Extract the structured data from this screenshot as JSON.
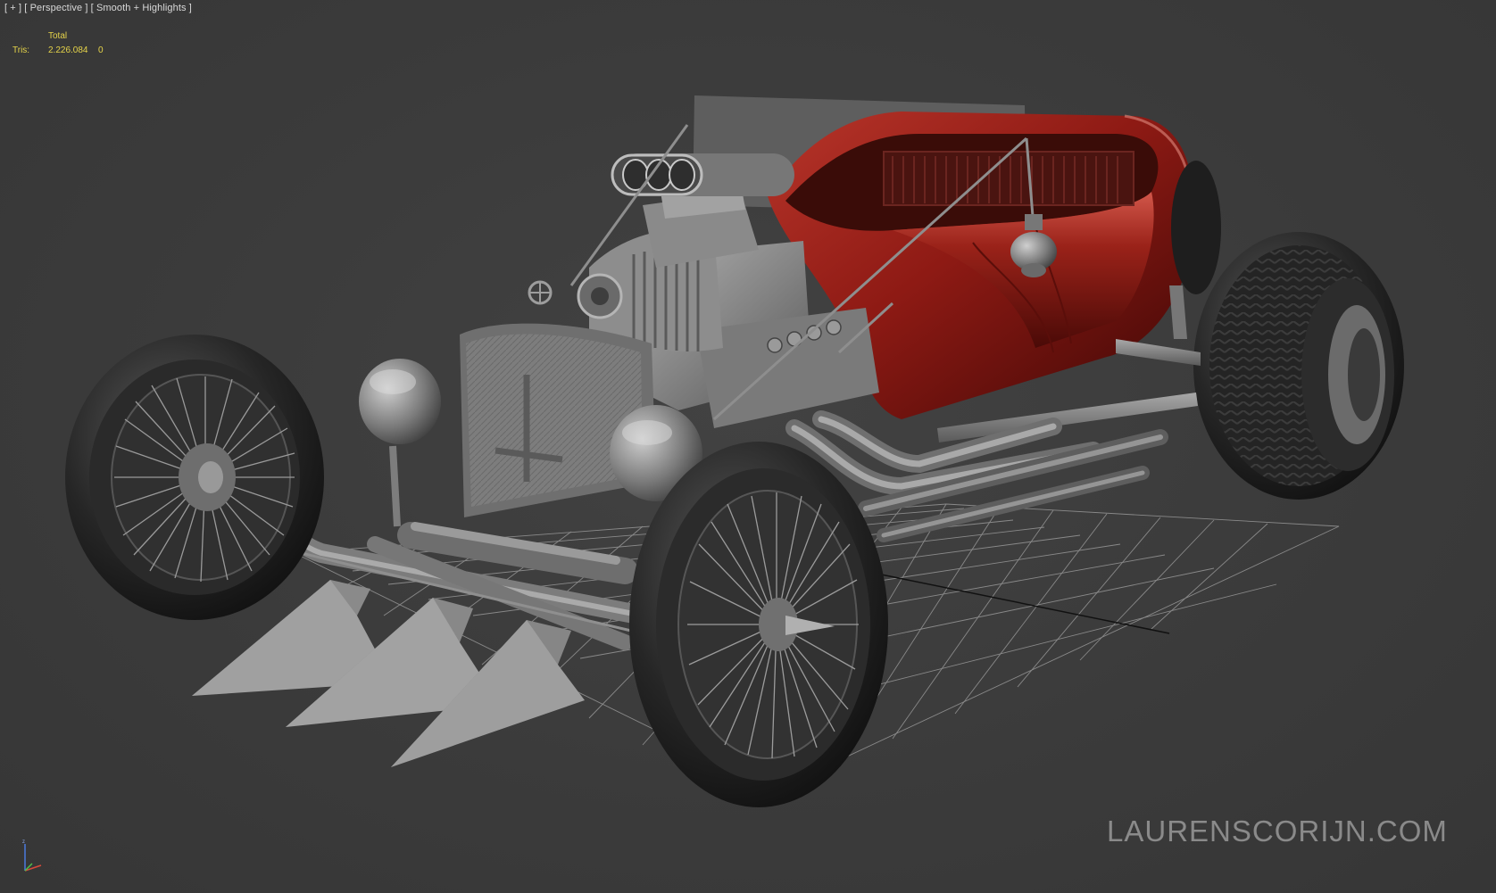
{
  "viewport": {
    "label": "[ + ] [ Perspective ] [ Smooth + Highlights ]",
    "stats": {
      "header": "Total",
      "row_label": "Tris:",
      "total": "2.226.084",
      "selected": "0"
    }
  },
  "watermark": "LAURENSCORIJN.COM",
  "colors": {
    "viewport_bg": "#3a3a3a",
    "stats_text": "#e6d44a",
    "body_red": "#8e1a14",
    "metal_gray": "#8a8a8a",
    "grid": "#9a9a9a"
  },
  "icons": {
    "axis_gizmo": "xyz-axis-tripod-icon"
  }
}
